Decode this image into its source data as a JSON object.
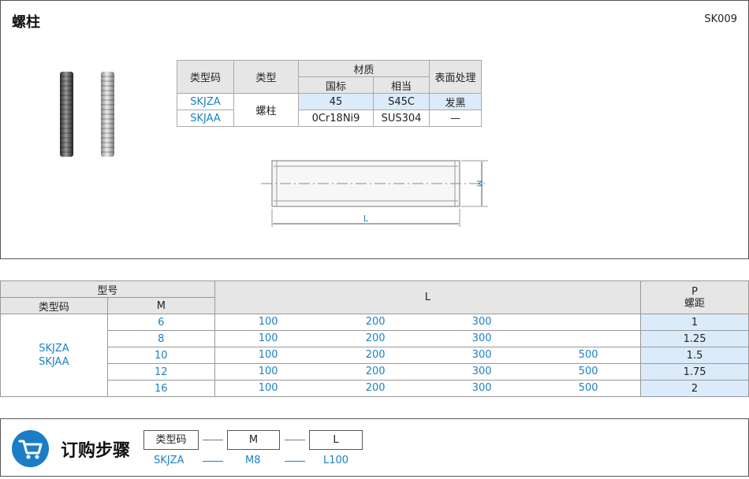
{
  "header": {
    "title": "螺柱",
    "code": "SK009"
  },
  "spec_table": {
    "headers": {
      "type_code": "类型码",
      "type": "类型",
      "material": "材质",
      "national": "国标",
      "equivalent": "相当",
      "surface": "表面处理"
    },
    "rows": [
      {
        "code": "SKJZA",
        "national": "45",
        "equivalent": "S45C",
        "surface": "发黑"
      },
      {
        "code": "SKJAA",
        "national": "0Cr18Ni9",
        "equivalent": "SUS304",
        "surface": "—"
      }
    ],
    "type_value": "螺柱"
  },
  "drawing": {
    "m_label": "M",
    "l_label": "L"
  },
  "selection_table": {
    "model_header": "型号",
    "type_code_header": "类型码",
    "m_header": "M",
    "l_header": "L",
    "p_header": "P",
    "p_sub": "螺距",
    "codes_line1": "SKJZA",
    "codes_line2": "SKJAA",
    "rows": [
      {
        "m": "6",
        "l1": "100",
        "l2": "200",
        "l3": "300",
        "l4": "",
        "p": "1"
      },
      {
        "m": "8",
        "l1": "100",
        "l2": "200",
        "l3": "300",
        "l4": "",
        "p": "1.25"
      },
      {
        "m": "10",
        "l1": "100",
        "l2": "200",
        "l3": "300",
        "l4": "500",
        "p": "1.5"
      },
      {
        "m": "12",
        "l1": "100",
        "l2": "200",
        "l3": "300",
        "l4": "500",
        "p": "1.75"
      },
      {
        "m": "16",
        "l1": "100",
        "l2": "200",
        "l3": "300",
        "l4": "500",
        "p": "2"
      }
    ]
  },
  "order": {
    "title": "订购步骤",
    "boxes": [
      "类型码",
      "M",
      "L"
    ],
    "values": [
      "SKJZA",
      "M8",
      "L100"
    ],
    "icon": "cart-icon",
    "accent": "#1b7dc6"
  }
}
